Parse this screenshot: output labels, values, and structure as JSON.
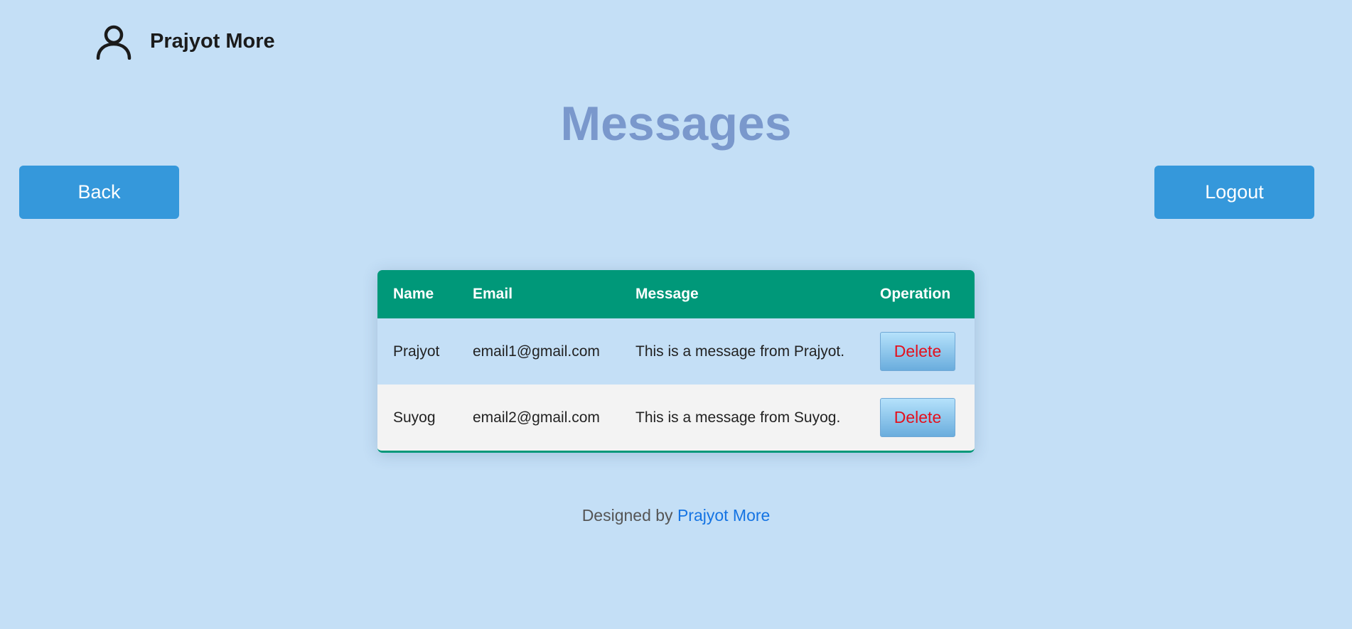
{
  "header": {
    "user_name": "Prajyot More",
    "user_icon": "user-icon"
  },
  "page": {
    "title": "Messages"
  },
  "nav": {
    "back_label": "Back",
    "logout_label": "Logout"
  },
  "table": {
    "columns": [
      "Name",
      "Email",
      "Message",
      "Operation"
    ],
    "rows": [
      {
        "name": "Prajyot",
        "email": "email1@gmail.com",
        "message": "This is a message from Prajyot.",
        "action": "Delete"
      },
      {
        "name": "Suyog",
        "email": "email2@gmail.com",
        "message": "This is a message from Suyog.",
        "action": "Delete"
      }
    ]
  },
  "footer": {
    "prefix": "Designed by",
    "author": "Prajyot More"
  },
  "colors": {
    "background": "#c4dff6",
    "button": "#3598db",
    "table_header": "#009879",
    "title": "#7a98cc",
    "delete_text": "#e4101d",
    "link": "#1574e3"
  }
}
